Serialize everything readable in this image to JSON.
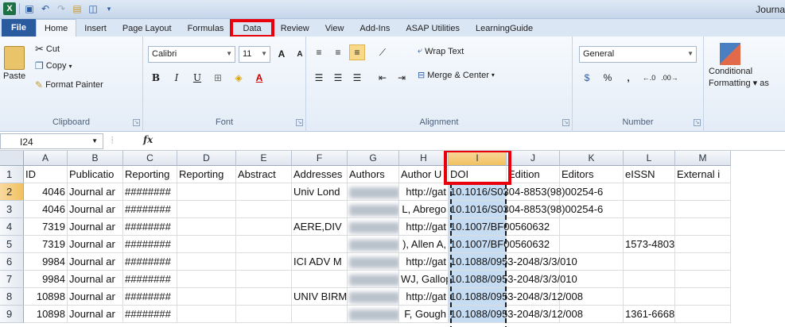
{
  "title_bar": {
    "document_title": "Journa"
  },
  "ribbon_tabs": [
    {
      "label": "File"
    },
    {
      "label": "Home"
    },
    {
      "label": "Insert"
    },
    {
      "label": "Page Layout"
    },
    {
      "label": "Formulas"
    },
    {
      "label": "Data"
    },
    {
      "label": "Review"
    },
    {
      "label": "View"
    },
    {
      "label": "Add-Ins"
    },
    {
      "label": "ASAP Utilities"
    },
    {
      "label": "LearningGuide"
    }
  ],
  "clipboard": {
    "paste": "Paste",
    "cut": "Cut",
    "copy": "Copy",
    "format_painter": "Format Painter",
    "group": "Clipboard"
  },
  "font": {
    "name": "Calibri",
    "size": "11",
    "bold": "B",
    "italic": "I",
    "underline": "U",
    "group": "Font"
  },
  "alignment": {
    "wrap_text": "Wrap Text",
    "merge_center": "Merge & Center",
    "group": "Alignment"
  },
  "number": {
    "format": "General",
    "percent": "%",
    "comma": ",",
    "group": "Number"
  },
  "styles": {
    "conditional": "Conditional",
    "formatting": "Formatting",
    "as": "as"
  },
  "formula_bar": {
    "name_box": "I24",
    "fx": "fx"
  },
  "columns": [
    "A",
    "B",
    "C",
    "D",
    "E",
    "F",
    "G",
    "H",
    "I",
    "J",
    "K",
    "L",
    "M"
  ],
  "header_row": {
    "id": "ID",
    "pub": "Publicatio",
    "rep1": "Reporting",
    "rep2": "Reporting",
    "abstract": "Abstract",
    "addr": "Addresses",
    "authors": "Authors",
    "author_u": "Author U",
    "doi": "DOI",
    "edition": "Edition",
    "editors": "Editors",
    "eissn": "eISSN",
    "external": "External i"
  },
  "rows": [
    {
      "n": "2",
      "a": "4046",
      "b": "Journal ar",
      "c": "########",
      "f": "Univ Lond",
      "h": "http://gat",
      "i": "10.1016/S0304-8853(98)00254-6",
      "l": ""
    },
    {
      "n": "3",
      "a": "4046",
      "b": "Journal ar",
      "c": "########",
      "f": "",
      "h": "L, Abrego",
      "i": "10.1016/S0304-8853(98)00254-6",
      "l": ""
    },
    {
      "n": "4",
      "a": "7319",
      "b": "Journal ar",
      "c": "########",
      "f": "AERE,DIV",
      "h": "http://gat",
      "i": "10.1007/BF00560632",
      "l": ""
    },
    {
      "n": "5",
      "a": "7319",
      "b": "Journal ar",
      "c": "########",
      "f": "",
      "h": "), Allen A,",
      "i": "10.1007/BF00560632",
      "l": "1573-4803"
    },
    {
      "n": "6",
      "a": "9984",
      "b": "Journal ar",
      "c": "########",
      "f": "ICI ADV M",
      "h": "http://gat",
      "i": "10.1088/0953-2048/3/3/010",
      "l": ""
    },
    {
      "n": "7",
      "a": "9984",
      "b": "Journal ar",
      "c": "########",
      "f": "",
      "h": "WJ, Gallop",
      "i": "10.1088/0953-2048/3/3/010",
      "l": ""
    },
    {
      "n": "8",
      "a": "10898",
      "b": "Journal ar",
      "c": "########",
      "f": "UNIV BIRM",
      "h": "http://gat",
      "i": "10.1088/0953-2048/3/12/008",
      "l": ""
    },
    {
      "n": "9",
      "a": "10898",
      "b": "Journal ar",
      "c": "########",
      "f": "",
      "h": "F, Gough",
      "i": "10.1088/0953-2048/3/12/008",
      "l": "1361-6668"
    }
  ],
  "row_one": "1"
}
